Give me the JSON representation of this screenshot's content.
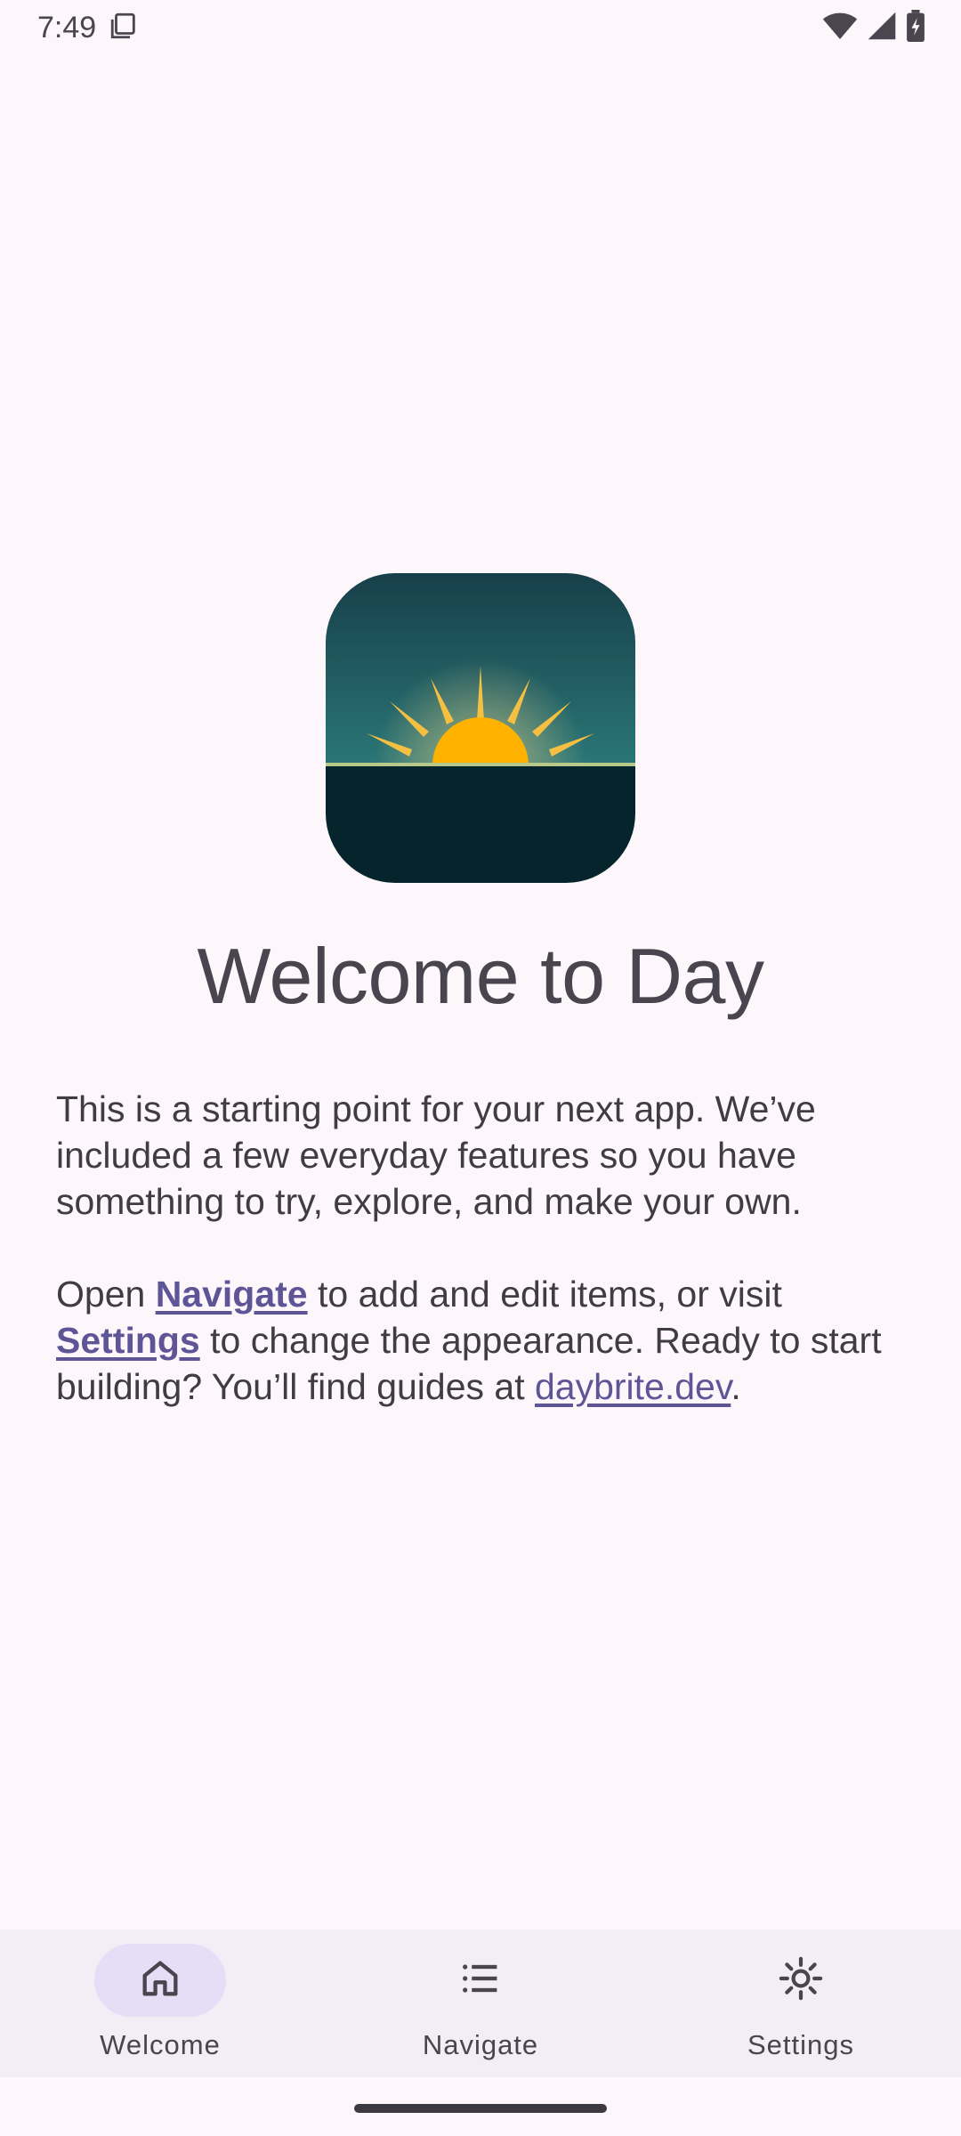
{
  "status": {
    "time": "7:49"
  },
  "welcome": {
    "title": "Welcome to Day",
    "paragraph1": "This is a starting point for your next app. We’ve included a few everyday features so you have something to try, explore, and make your own.",
    "p2_open": "Open ",
    "p2_navigate_link": "Navigate",
    "p2_middle1": " to add and edit items, or visit ",
    "p2_settings_link": "Settings",
    "p2_middle2": " to change the appearance. Ready to start building? You’ll find guides at ",
    "p2_site_link": "daybrite.dev",
    "p2_end": "."
  },
  "nav": {
    "items": [
      {
        "label": "Welcome",
        "icon": "home-icon",
        "active": true
      },
      {
        "label": "Navigate",
        "icon": "list-icon",
        "active": false
      },
      {
        "label": "Settings",
        "icon": "brightness-icon",
        "active": false
      }
    ]
  },
  "colors": {
    "background": "#fdf7fc",
    "accent": "#5e5596",
    "nav_background": "#f3edf6",
    "nav_active_pill": "#e6ddf6",
    "logo_sky_top": "#173f4a",
    "logo_sky_bottom": "#2a7676",
    "logo_ground": "#06242b",
    "logo_sun": "#ffb300"
  }
}
